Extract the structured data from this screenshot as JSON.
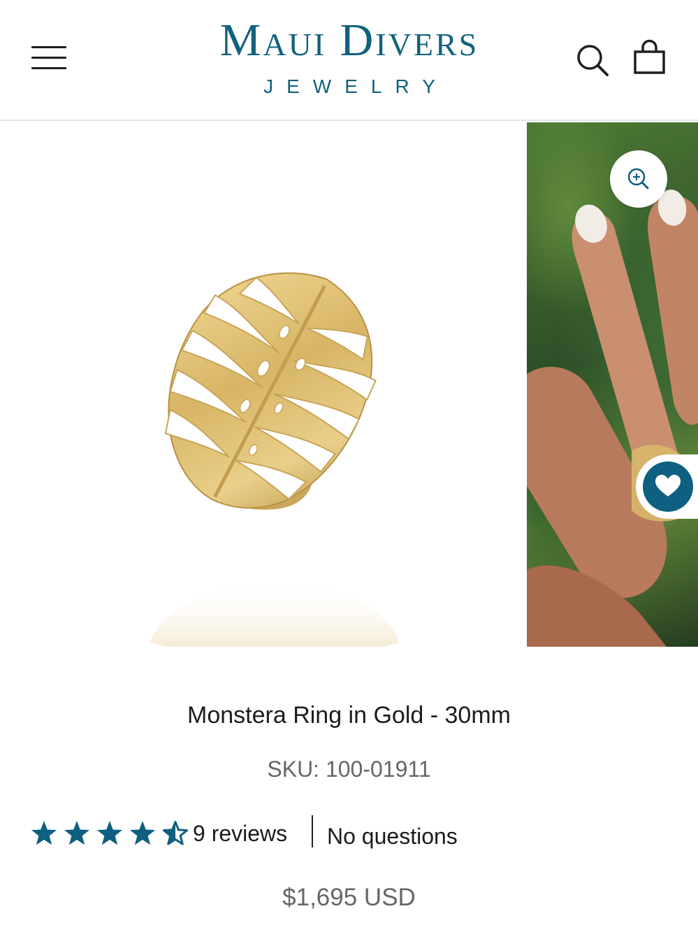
{
  "header": {
    "logo_main": "Maui Divers",
    "logo_sub": "JEWELRY",
    "menu_icon": "hamburger-menu-icon",
    "search_icon": "search-icon",
    "cart_icon": "shopping-bag-icon",
    "brand_color": "#11617e"
  },
  "gallery": {
    "zoom_icon": "zoom-in-icon",
    "wishlist_icon": "heart-icon",
    "accent_color": "#0e5f80"
  },
  "product": {
    "title": "Monstera Ring in Gold - 30mm",
    "sku": "SKU: 100-01911",
    "rating": 4.5,
    "rating_max": 5,
    "reviews_label": "9 reviews",
    "questions_label": "No questions",
    "price": "$1,695 USD",
    "star_color": "#0e5f80"
  }
}
